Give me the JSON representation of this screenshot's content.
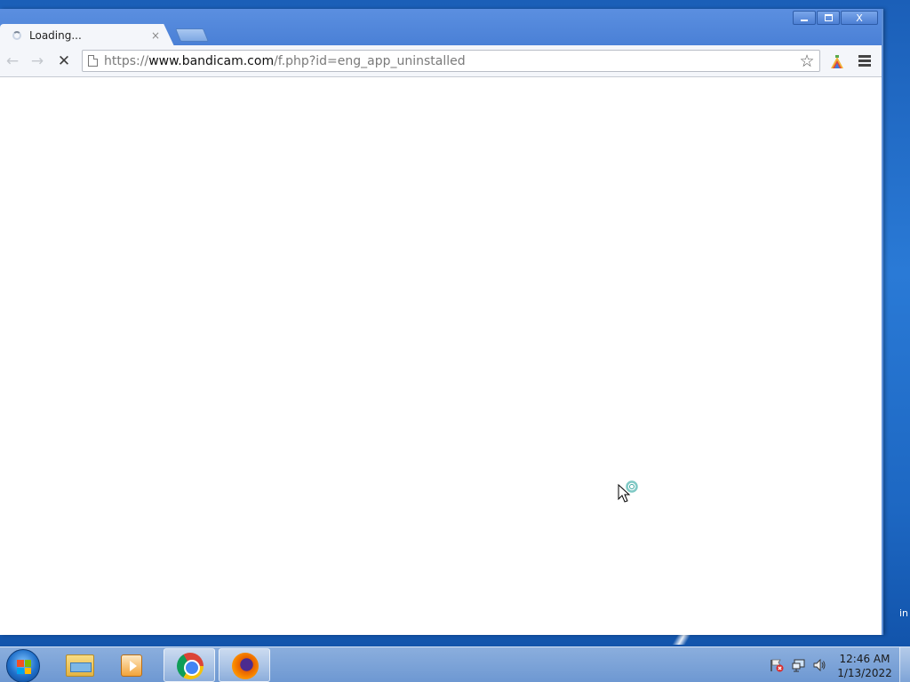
{
  "desktop": {
    "corner_text": "in"
  },
  "window": {
    "controls": {
      "minimize": "",
      "maximize": "",
      "close": "X"
    }
  },
  "tab": {
    "title": "Loading...",
    "close_label": "×",
    "icon": "spinner-icon"
  },
  "toolbar": {
    "back": "←",
    "forward": "→",
    "stop": "✕",
    "url_scheme": "https://",
    "url_host": "www.bandicam.com",
    "url_path": "/f.php?id=eng_app_uninstalled",
    "star": "☆"
  },
  "taskbar": {
    "apps": [
      {
        "name": "Windows Explorer",
        "icon": "explorer-icon"
      },
      {
        "name": "Windows Media Player",
        "icon": "media-player-icon"
      },
      {
        "name": "Google Chrome",
        "icon": "chrome-icon",
        "active": true
      },
      {
        "name": "Mozilla Firefox",
        "icon": "firefox-icon",
        "active": true
      }
    ],
    "clock": {
      "time": "12:46 AM",
      "date": "1/13/2022"
    }
  },
  "colors": {
    "title_bar": "#4a80d6",
    "desktop": "#2a7ad6",
    "toolbar": "#f4f6fa"
  }
}
